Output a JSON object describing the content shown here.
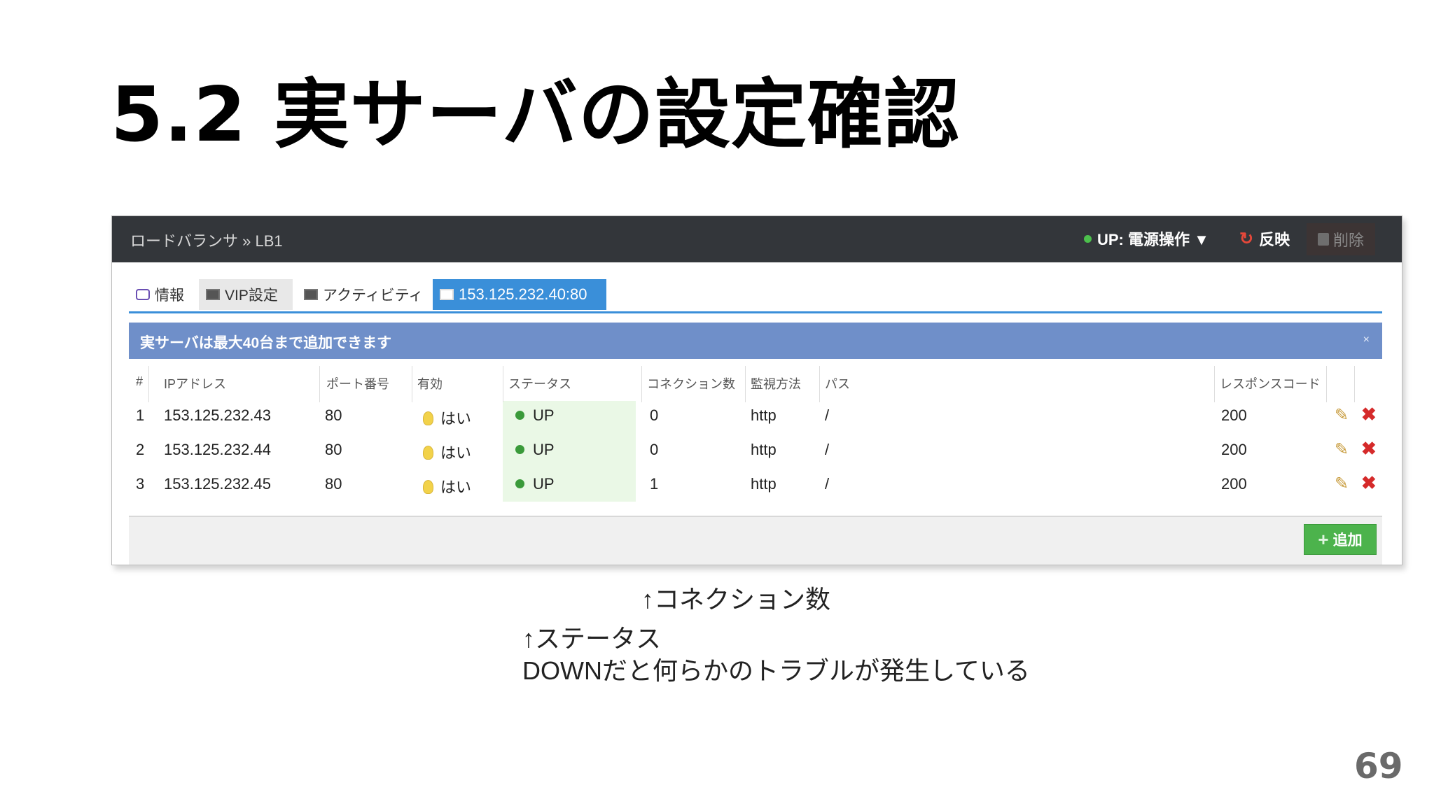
{
  "slide": {
    "title": "5.2 実サーバの設定確認",
    "page_number": "69"
  },
  "panel": {
    "breadcrumb": "ロードバランサ » LB1",
    "power_status": "UP: 電源操作 ▼",
    "reflect_label": "反映",
    "delete_label": "削除",
    "tabs": [
      "情報",
      "VIP設定",
      "アクティビティ",
      "153.125.232.40:80"
    ],
    "notice": "実サーバは最大40台まで追加できます",
    "notice_close": "×",
    "columns": [
      "#",
      "IPアドレス",
      "ポート番号",
      "有効",
      "ステータス",
      "コネクション数",
      "監視方法",
      "パス",
      "レスポンスコード"
    ],
    "rows": [
      {
        "num": "1",
        "ip": "153.125.232.43",
        "port": "80",
        "enabled": "はい",
        "status": "UP",
        "connections": "0",
        "method": "http",
        "path": "/",
        "code": "200"
      },
      {
        "num": "2",
        "ip": "153.125.232.44",
        "port": "80",
        "enabled": "はい",
        "status": "UP",
        "connections": "0",
        "method": "http",
        "path": "/",
        "code": "200"
      },
      {
        "num": "3",
        "ip": "153.125.232.45",
        "port": "80",
        "enabled": "はい",
        "status": "UP",
        "connections": "1",
        "method": "http",
        "path": "/",
        "code": "200"
      }
    ],
    "add_label": "追加"
  },
  "annotations": {
    "connections_note": "↑コネクション数",
    "status_note": "↑ステータス",
    "status_detail": "DOWNだと何らかのトラブルが発生している"
  },
  "colors": {
    "header_bg": "#33363a",
    "active_tab": "#3a8fd9",
    "notice_bg": "#6f8fc9",
    "status_up": "#3a9a3a",
    "add_button": "#4cb34c"
  }
}
